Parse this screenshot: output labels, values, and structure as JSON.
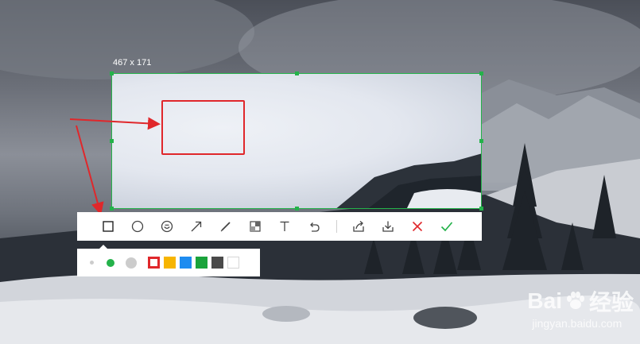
{
  "capture": {
    "size_label": "467 x 171"
  },
  "toolbar": {
    "tools": [
      {
        "name": "rectangle-tool",
        "icon": "square-icon"
      },
      {
        "name": "ellipse-tool",
        "icon": "circle-icon"
      },
      {
        "name": "emoji-tool",
        "icon": "smile-icon"
      },
      {
        "name": "arrow-tool",
        "icon": "arrow-icon"
      },
      {
        "name": "pen-tool",
        "icon": "pen-icon"
      },
      {
        "name": "mosaic-tool",
        "icon": "mosaic-icon"
      },
      {
        "name": "text-tool",
        "icon": "text-icon"
      },
      {
        "name": "undo-tool",
        "icon": "undo-icon"
      }
    ],
    "actions": [
      {
        "name": "share-button",
        "icon": "share-icon"
      },
      {
        "name": "download-button",
        "icon": "download-icon"
      },
      {
        "name": "cancel-button",
        "icon": "close-icon"
      },
      {
        "name": "confirm-button",
        "icon": "check-icon"
      }
    ]
  },
  "palette": {
    "sizes": [
      "small",
      "medium",
      "large"
    ],
    "selected_size": "medium",
    "colors": [
      "#e0272b",
      "#f7b500",
      "#1e8cf0",
      "#1aa33b",
      "#4a4a4a",
      "#ffffff"
    ],
    "selected_color": "#e0272b",
    "accent": "#24b24a"
  },
  "watermark": {
    "brand": "Bai",
    "suffix": "经验",
    "url": "jingyan.baidu.com"
  }
}
